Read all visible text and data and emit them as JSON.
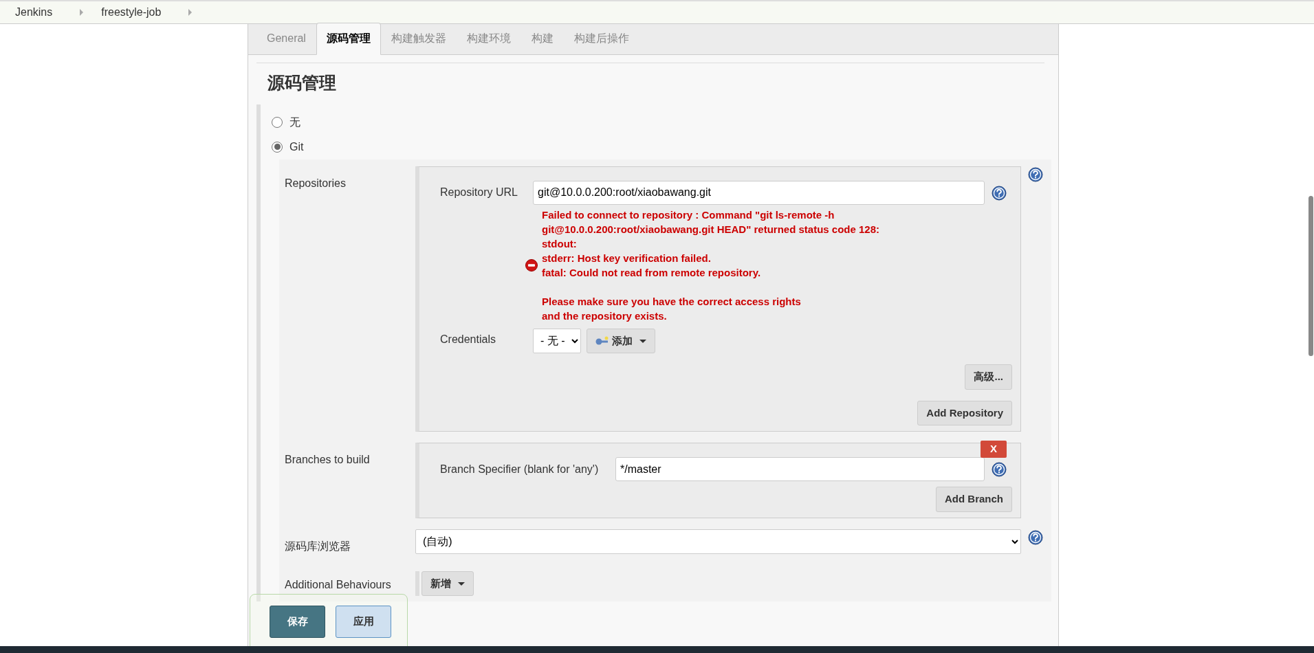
{
  "breadcrumbs": [
    "Jenkins",
    "freestyle-job"
  ],
  "tabs": [
    {
      "label": "General",
      "selected": false
    },
    {
      "label": "源码管理",
      "selected": true
    },
    {
      "label": "构建触发器",
      "selected": false
    },
    {
      "label": "构建环境",
      "selected": false
    },
    {
      "label": "构建",
      "selected": false
    },
    {
      "label": "构建后操作",
      "selected": false
    }
  ],
  "section_title": "源码管理",
  "scm_options": [
    {
      "label": "无",
      "selected": false
    },
    {
      "label": "Git",
      "selected": true
    }
  ],
  "repositories": {
    "label": "Repositories",
    "url_label": "Repository URL",
    "url_value": "git@10.0.0.200:root/xiaobawang.git",
    "error_paragraphs": [
      "Failed to connect to repository : Command \"git ls-remote -h\ngit@10.0.0.200:root/xiaobawang.git HEAD\" returned status code 128:\nstdout:\nstderr: Host key verification failed.\nfatal: Could not read from remote repository.",
      "Please make sure you have the correct access rights\nand the repository exists."
    ],
    "credentials_label": "Credentials",
    "credentials_value": "- 无 -",
    "add_credentials_button": "添加",
    "advanced_button": "高级...",
    "add_repository_button": "Add Repository"
  },
  "branches": {
    "label": "Branches to build",
    "remove_button": "X",
    "specifier_label": "Branch Specifier (blank for 'any')",
    "specifier_value": "*/master",
    "add_branch_button": "Add Branch"
  },
  "repo_browser": {
    "label": "源码库浏览器",
    "value": "(自动)"
  },
  "additional_behaviours": {
    "label": "Additional Behaviours",
    "add_button": "新增"
  },
  "footer_buttons": [
    {
      "label": "保存",
      "kind": "primary"
    },
    {
      "label": "应用",
      "kind": "secondary"
    }
  ]
}
